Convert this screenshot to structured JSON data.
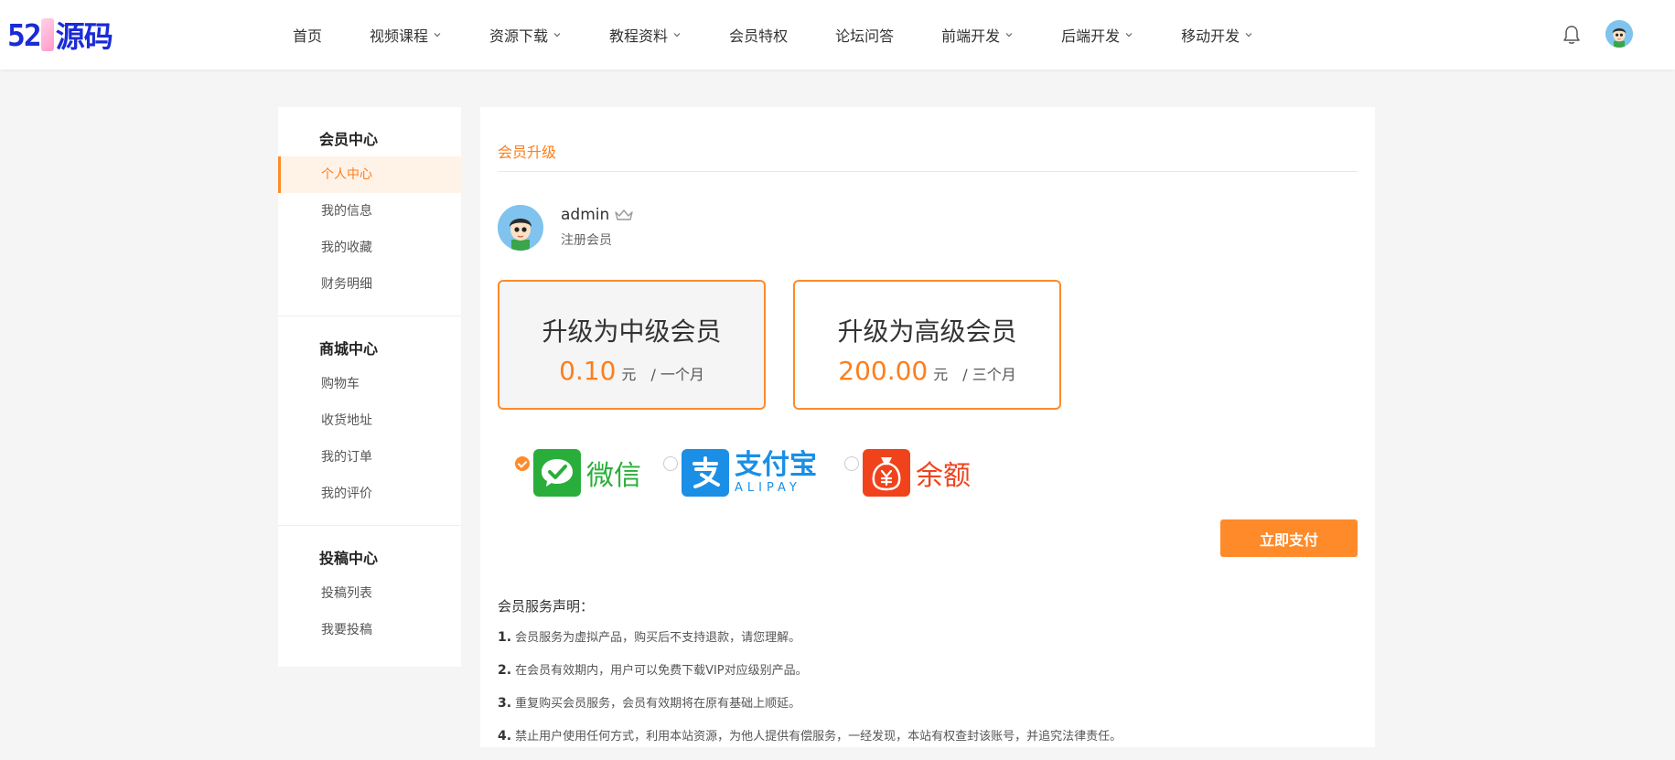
{
  "logo": {
    "num": "52",
    "cn": "源码"
  },
  "nav": [
    {
      "label": "首页",
      "dropdown": false
    },
    {
      "label": "视频课程",
      "dropdown": true
    },
    {
      "label": "资源下载",
      "dropdown": true
    },
    {
      "label": "教程资料",
      "dropdown": true
    },
    {
      "label": "会员特权",
      "dropdown": false
    },
    {
      "label": "论坛问答",
      "dropdown": false
    },
    {
      "label": "前端开发",
      "dropdown": true
    },
    {
      "label": "后端开发",
      "dropdown": true
    },
    {
      "label": "移动开发",
      "dropdown": true
    }
  ],
  "sidebar": {
    "groups": [
      {
        "title": "会员中心",
        "items": [
          "个人中心",
          "我的信息",
          "我的收藏",
          "财务明细"
        ]
      },
      {
        "title": "商城中心",
        "items": [
          "购物车",
          "收货地址",
          "我的订单",
          "我的评价"
        ]
      },
      {
        "title": "投稿中心",
        "items": [
          "投稿列表",
          "我要投稿"
        ]
      }
    ],
    "active": "个人中心"
  },
  "main": {
    "tab": "会员升级",
    "user": {
      "name": "admin",
      "level": "注册会员"
    },
    "plans": [
      {
        "title": "升级为中级会员",
        "amount": "0.10",
        "unit": "元",
        "period": "/ 一个月",
        "selected": true
      },
      {
        "title": "升级为高级会员",
        "amount": "200.00",
        "unit": "元",
        "period": "/ 三个月",
        "selected": false
      }
    ],
    "payments": [
      {
        "label": "微信",
        "icon": "wechat-pay-icon",
        "checked": true
      },
      {
        "label": "支付宝",
        "sublabel": "ALIPAY",
        "icon": "alipay-icon",
        "checked": false
      },
      {
        "label": "余额",
        "icon": "balance-icon",
        "checked": false
      }
    ],
    "pay_button": "立即支付",
    "notice_title": "会员服务声明：",
    "notices": [
      {
        "num": "1.",
        "text": "会员服务为虚拟产品，购买后不支持退款，请您理解。"
      },
      {
        "num": "2.",
        "text": "在会员有效期内，用户可以免费下载VIP对应级别产品。"
      },
      {
        "num": "3.",
        "text": "重复购买会员服务，会员有效期将在原有基础上顺延。"
      },
      {
        "num": "4.",
        "text": "禁止用户使用任何方式，利用本站资源，为他人提供有偿服务，一经发现，本站有权查封该账号，并追究法律责任。"
      }
    ]
  },
  "colors": {
    "accent": "#ff8a2a",
    "accent_text": "#ff7d1a",
    "logo_blue": "#1a2bd8",
    "wechat": "#2aae3b",
    "alipay": "#1b8fe6",
    "balance": "#f0431c"
  }
}
